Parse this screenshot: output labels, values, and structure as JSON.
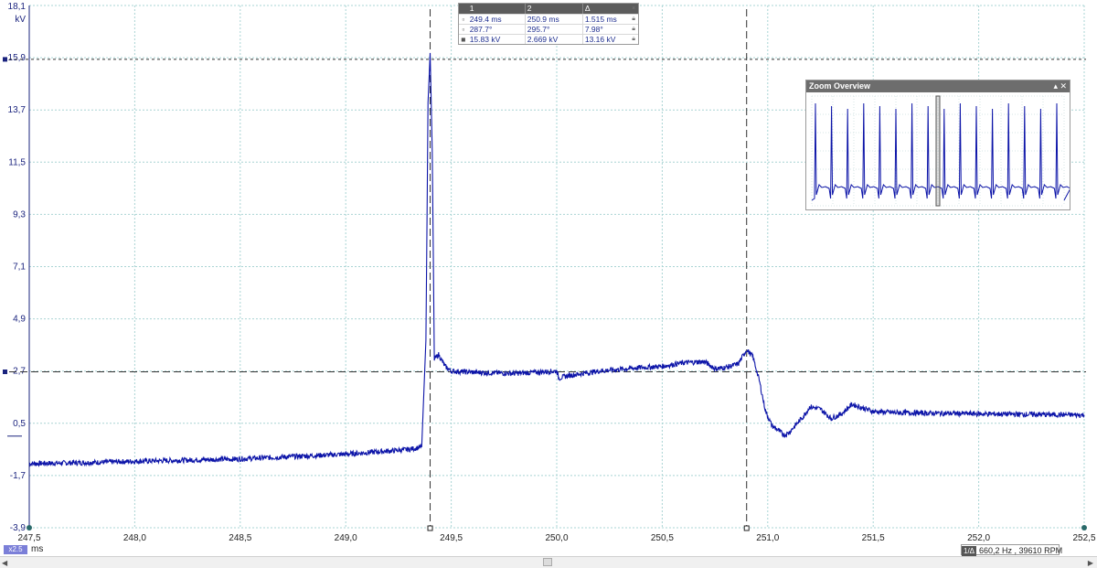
{
  "chart_data": {
    "type": "line",
    "title": "",
    "xlabel": "ms",
    "ylabel": "kV",
    "xlim": [
      247.5,
      252.5
    ],
    "ylim": [
      -3.9,
      18.1
    ],
    "y_ticks": [
      "18,1",
      "15,9",
      "13,7",
      "11,5",
      "9,3",
      "7,1",
      "4,9",
      "2,7",
      "0,5",
      "-1,7",
      "-3,9"
    ],
    "x_ticks": [
      "247,5",
      "248,0",
      "248,5",
      "249,0",
      "249,5",
      "250,0",
      "250,5",
      "251,0",
      "251,5",
      "252,0",
      "252,5"
    ],
    "grid": true,
    "cursors": {
      "vertical_ms": [
        249.4,
        250.9
      ],
      "horizontal_kV": [
        15.83,
        2.669
      ]
    },
    "series": [
      {
        "x": [
          247.5,
          247.8,
          248.0,
          248.5,
          249.0,
          249.3,
          249.36,
          249.38,
          249.39,
          249.4,
          249.41,
          249.42,
          249.44,
          249.47,
          249.5,
          249.6,
          249.8,
          250.0,
          250.01,
          250.05,
          250.2,
          250.4,
          250.5,
          250.6,
          250.7,
          250.75,
          250.8,
          250.86,
          250.9,
          250.93,
          250.96,
          250.99,
          251.02,
          251.05,
          251.08,
          251.1,
          251.13,
          251.17,
          251.2,
          251.25,
          251.3,
          251.35,
          251.4,
          251.5,
          251.6,
          252.0,
          252.5
        ],
        "y": [
          -1.2,
          -1.15,
          -1.1,
          -1.0,
          -0.8,
          -0.6,
          -0.5,
          4.0,
          14.0,
          16.1,
          12.0,
          3.2,
          3.4,
          2.9,
          2.7,
          2.65,
          2.6,
          2.7,
          2.4,
          2.5,
          2.7,
          2.85,
          2.9,
          3.05,
          3.1,
          2.8,
          2.85,
          3.0,
          3.6,
          3.3,
          2.3,
          1.0,
          0.4,
          0.2,
          0.0,
          0.1,
          0.4,
          0.8,
          1.2,
          1.1,
          0.7,
          0.9,
          1.3,
          1.0,
          0.95,
          0.9,
          0.85
        ]
      }
    ]
  },
  "axes": {
    "y_unit": "kV",
    "x_unit": "ms"
  },
  "cursor_table": {
    "headers": [
      "1",
      "2",
      "Δ"
    ],
    "close_icon": "×",
    "rows": [
      {
        "icon": "cursor-time-icon",
        "c1": "249.4 ms",
        "c2": "250.9 ms",
        "d": "1.515 ms"
      },
      {
        "icon": "cursor-angle-icon",
        "c1": "287.7°",
        "c2": "295.7°",
        "d": "7.98°"
      },
      {
        "icon": "cursor-voltage-icon",
        "c1": "15.83 kV",
        "c2": "2.669 kV",
        "d": "13.16 kV"
      }
    ]
  },
  "zoom_overview": {
    "title": "Zoom Overview",
    "controls": "▴ ✕"
  },
  "status": {
    "zoom_badge": "x2.5",
    "freq_icon": "1/Δ",
    "freq_text": "660,2 Hz , 39610 RPM"
  },
  "colors": {
    "trace": "#0c14a8",
    "grid": "#a9d4d4",
    "cursor": "#333333",
    "panel_header": "#5c5c5c"
  }
}
